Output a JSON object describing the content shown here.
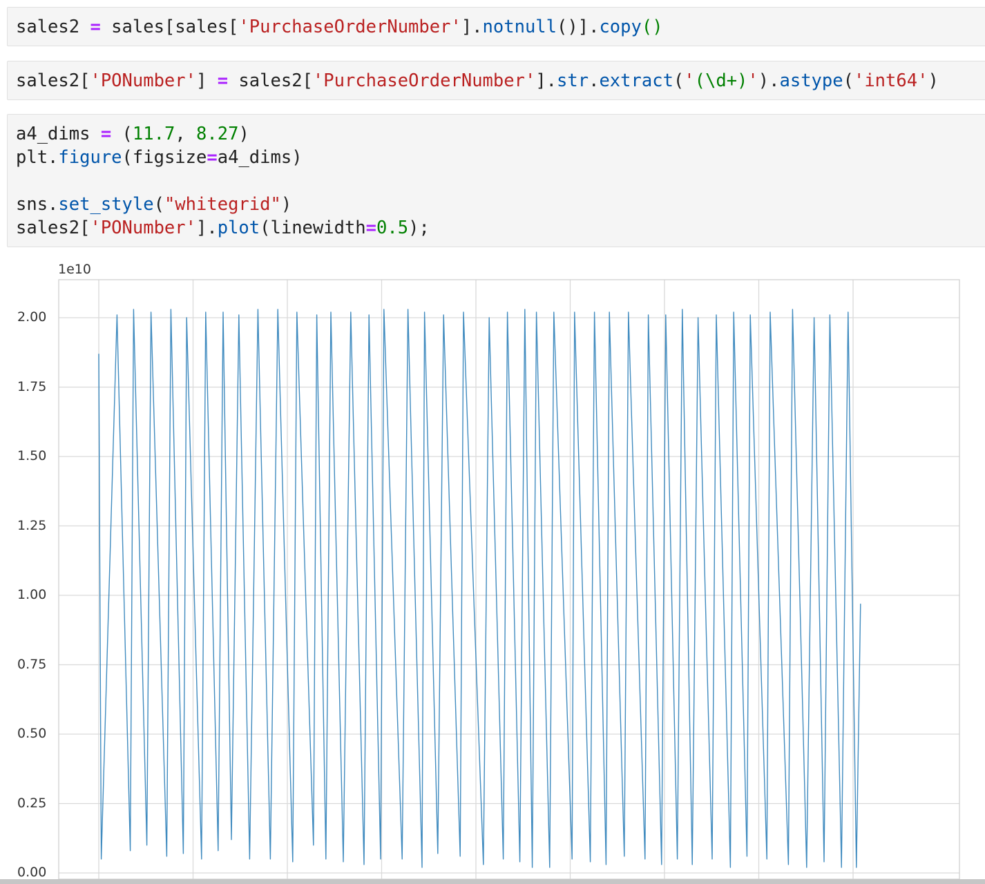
{
  "cells": [
    {
      "tokens": [
        {
          "t": "sales2 "
        },
        {
          "t": "=",
          "c": "o"
        },
        {
          "t": " sales[sales["
        },
        {
          "t": "'PurchaseOrderNumber'",
          "c": "s"
        },
        {
          "t": "]."
        },
        {
          "t": "notnull",
          "c": "f"
        },
        {
          "t": "()]."
        },
        {
          "t": "copy",
          "c": "f"
        },
        {
          "t": "()",
          "c": "n"
        }
      ]
    },
    {
      "tokens": [
        {
          "t": "sales2["
        },
        {
          "t": "'PONumber'",
          "c": "s"
        },
        {
          "t": "] "
        },
        {
          "t": "=",
          "c": "o"
        },
        {
          "t": " sales2["
        },
        {
          "t": "'PurchaseOrderNumber'",
          "c": "s"
        },
        {
          "t": "]."
        },
        {
          "t": "str",
          "c": "f"
        },
        {
          "t": "."
        },
        {
          "t": "extract",
          "c": "f"
        },
        {
          "t": "("
        },
        {
          "t": "'",
          "c": "s"
        },
        {
          "t": "(\\d+)",
          "c": "n"
        },
        {
          "t": "'",
          "c": "s"
        },
        {
          "t": ")."
        },
        {
          "t": "astype",
          "c": "f"
        },
        {
          "t": "("
        },
        {
          "t": "'int64'",
          "c": "s"
        },
        {
          "t": ")"
        }
      ]
    },
    {
      "tokens": [
        {
          "t": "a4_dims "
        },
        {
          "t": "=",
          "c": "o"
        },
        {
          "t": " ("
        },
        {
          "t": "11.7",
          "c": "n"
        },
        {
          "t": ", "
        },
        {
          "t": "8.27",
          "c": "n"
        },
        {
          "t": ")\nplt."
        },
        {
          "t": "figure",
          "c": "f"
        },
        {
          "t": "(figsize"
        },
        {
          "t": "=",
          "c": "o"
        },
        {
          "t": "a4_dims)\n\nsns."
        },
        {
          "t": "set_style",
          "c": "f"
        },
        {
          "t": "("
        },
        {
          "t": "\"whitegrid\"",
          "c": "s"
        },
        {
          "t": ")\nsales2["
        },
        {
          "t": "'PONumber'",
          "c": "s"
        },
        {
          "t": "]."
        },
        {
          "t": "plot",
          "c": "f"
        },
        {
          "t": "(linewidth"
        },
        {
          "t": "=",
          "c": "o"
        },
        {
          "t": "0.5",
          "c": "n"
        },
        {
          "t": ");"
        }
      ]
    }
  ],
  "chart_data": {
    "type": "line",
    "title": "",
    "xlabel": "",
    "ylabel": "",
    "y_offset_label": "1e10",
    "y_ticks": [
      "0.00",
      "0.25",
      "0.50",
      "0.75",
      "1.00",
      "1.25",
      "1.50",
      "1.75",
      "2.00"
    ],
    "ylim": [
      0.0,
      2.12
    ],
    "x_tick_count": 9,
    "x_tick_labels_visible": false,
    "grid": true,
    "line_color": "#1f77b4",
    "linewidth": 0.5,
    "series": [
      {
        "x": [
          0,
          0.3,
          2.2,
          3.8,
          4.2,
          5.8,
          6.3,
          8.2,
          8.7,
          10.2,
          10.6,
          12.4,
          12.9,
          14.4,
          15.0,
          16.0,
          16.9,
          18.2,
          19.2,
          20.7,
          21.6,
          23.4,
          23.9,
          25.9,
          26.3,
          27.4,
          28.0,
          29.5,
          30.4,
          32.0,
          32.6,
          34.0,
          34.4,
          36.6,
          37.3,
          39.0,
          39.3,
          40.9,
          41.6,
          43.6,
          44.0,
          46.4,
          47.1,
          48.8,
          49.3,
          50.8,
          51.4,
          52.3,
          52.8,
          54.4,
          54.9,
          57.1,
          57.4,
          59.3,
          59.8,
          61.2,
          61.6,
          63.4,
          63.9,
          65.9,
          66.3,
          67.9,
          68.4,
          69.8,
          70.4,
          71.6,
          72.3,
          74.0,
          74.5,
          76.2,
          76.6,
          78.2,
          78.6,
          80.6,
          81.0,
          83.2,
          83.7,
          85.4,
          86.3,
          87.5,
          88.2,
          89.6,
          90.4,
          91.4,
          91.9
        ],
        "y": [
          1.87,
          0.05,
          2.01,
          0.08,
          2.03,
          0.1,
          2.02,
          0.06,
          2.03,
          0.07,
          2.0,
          0.05,
          2.02,
          0.08,
          2.02,
          0.12,
          2.01,
          0.05,
          2.03,
          0.05,
          2.03,
          0.04,
          2.02,
          0.1,
          2.01,
          0.05,
          2.02,
          0.04,
          2.02,
          0.03,
          2.01,
          0.05,
          2.03,
          0.05,
          2.03,
          0.02,
          2.02,
          0.07,
          2.01,
          0.06,
          2.02,
          0.03,
          2.0,
          0.05,
          2.02,
          0.04,
          2.03,
          0.02,
          2.02,
          0.02,
          2.02,
          0.05,
          2.02,
          0.04,
          2.02,
          0.03,
          2.02,
          0.06,
          2.02,
          0.05,
          2.01,
          0.03,
          2.01,
          0.05,
          2.03,
          0.03,
          2.0,
          0.05,
          2.01,
          0.02,
          2.02,
          0.06,
          2.01,
          0.05,
          2.02,
          0.03,
          2.03,
          0.02,
          2.0,
          0.04,
          2.01,
          0.02,
          2.02,
          0.02,
          0.97
        ]
      }
    ]
  }
}
